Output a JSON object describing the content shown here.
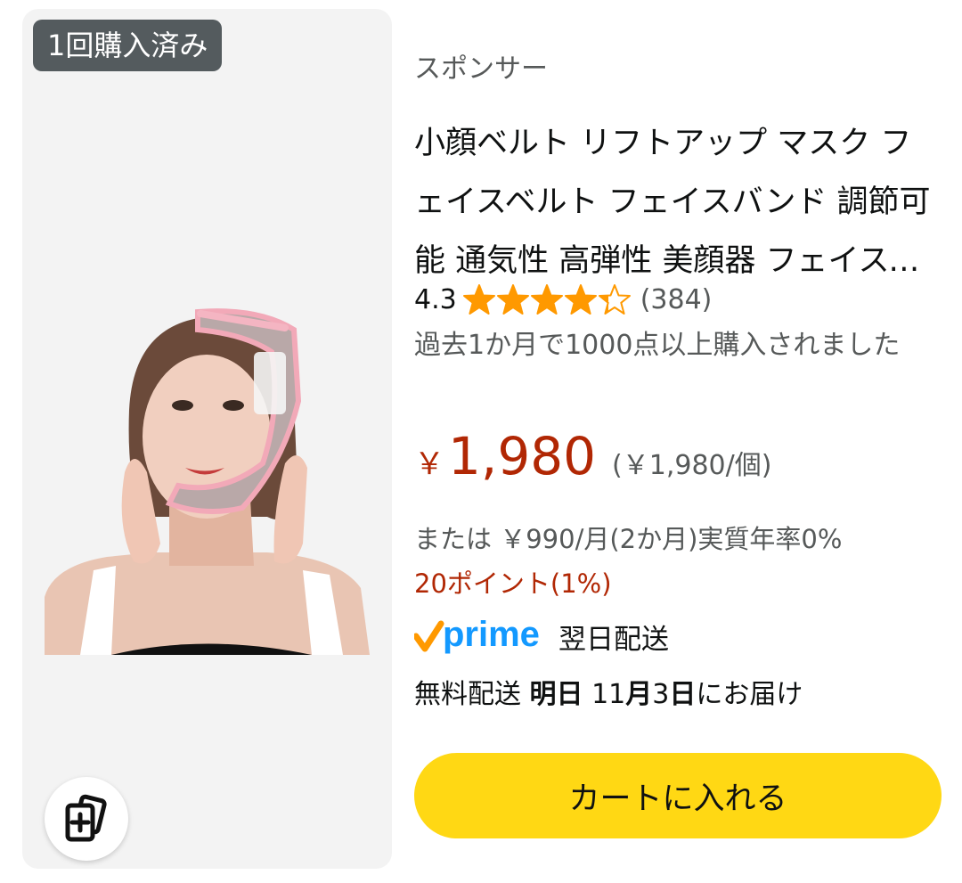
{
  "badge": {
    "purchased_label": "1回購入済み"
  },
  "product": {
    "sponsored_label": "スポンサー",
    "title": "小顔ベルト リフトアップ マスク フェイスベルト フェイスバンド 調節可能 通気性 高弾性 美顔器 フェイスマスク",
    "image_icon": "product-photo-face-lift-belt",
    "rating": {
      "value": "4.3",
      "stars_filled": 4.3,
      "stars_max": 5,
      "review_count": "(384)"
    },
    "bought_text": "過去1か月で1000点以上購入されました",
    "price": {
      "symbol": "￥",
      "value": "1,980",
      "unit_price": "(￥1,980/個)"
    },
    "installment_text": "または ￥990/月(2か月)実質年率0%",
    "points_text": "20ポイント(1%)",
    "prime": {
      "logo_text": "prime",
      "delivery_label": "翌日配送"
    },
    "delivery": {
      "prefix": "無料配送 ",
      "day_label": "明日",
      "space": " ",
      "month_num": "11",
      "month_unit": "月",
      "day_num": "3",
      "day_unit": "日",
      "suffix": "にお届け"
    },
    "cart_button_label": "カートに入れる",
    "compare_icon": "add-to-compare-icon"
  },
  "colors": {
    "price_red": "#b12704",
    "star_orange": "#ff9900",
    "cart_yellow": "#ffd814",
    "prime_blue": "#1399ff",
    "badge_gray": "#545b5e"
  }
}
